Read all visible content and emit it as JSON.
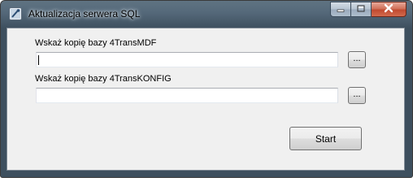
{
  "window": {
    "title": "Aktualizacja serwera SQL",
    "app_icon": "database-tool-icon",
    "buttons": [
      "minimize-icon",
      "maximize-icon",
      "close-icon"
    ]
  },
  "form": {
    "mdf_label": "Wskaż kopię bazy 4TransMDF",
    "mdf_value": "",
    "konfig_label": "Wskaż kopię bazy 4TransKONFIG",
    "konfig_value": "",
    "browse_label": "...",
    "start_label": "Start"
  }
}
